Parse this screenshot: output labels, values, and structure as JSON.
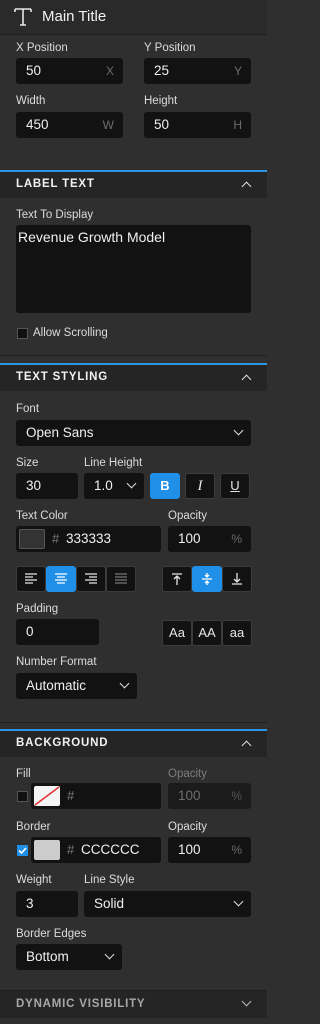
{
  "header": {
    "title": "Main Title",
    "icon": "text-tool-icon"
  },
  "position": {
    "x_label": "X Position",
    "x_value": "50",
    "x_unit": "X",
    "y_label": "Y Position",
    "y_value": "25",
    "y_unit": "Y",
    "w_label": "Width",
    "w_value": "450",
    "w_unit": "W",
    "h_label": "Height",
    "h_value": "50",
    "h_unit": "H"
  },
  "label_text": {
    "section_title": "LABEL TEXT",
    "text_label": "Text To Display",
    "text_value": "Revenue Growth Model",
    "scroll_label": "Allow Scrolling",
    "scroll_checked": false
  },
  "text_styling": {
    "section_title": "TEXT STYLING",
    "font_label": "Font",
    "font_value": "Open Sans",
    "size_label": "Size",
    "size_value": "30",
    "line_height_label": "Line Height",
    "line_height_value": "1.0",
    "bold_label": "B",
    "italic_label": "I",
    "underline_label": "U",
    "text_color_label": "Text Color",
    "text_color_hash": "#",
    "text_color_value": "333333",
    "opacity_label": "Opacity",
    "opacity_value": "100",
    "opacity_unit": "%",
    "padding_label": "Padding",
    "padding_value": "0",
    "case_buttons": [
      "Aa",
      "AA",
      "aa"
    ],
    "number_format_label": "Number Format",
    "number_format_value": "Automatic",
    "align_active": "center",
    "valign_active": "middle",
    "bold_active": true
  },
  "background": {
    "section_title": "BACKGROUND",
    "fill_label": "Fill",
    "fill_hash": "#",
    "fill_value": "",
    "fill_opacity_label": "Opacity",
    "fill_opacity_value": "100",
    "fill_opacity_unit": "%",
    "border_label": "Border",
    "border_hash": "#",
    "border_value": "CCCCCC",
    "border_opacity_label": "Opacity",
    "border_opacity_value": "100",
    "border_opacity_unit": "%",
    "weight_label": "Weight",
    "weight_value": "3",
    "line_style_label": "Line Style",
    "line_style_value": "Solid",
    "edges_label": "Border Edges",
    "edges_value": "Bottom",
    "border_color": "#cccccc",
    "fill_checked": false,
    "border_checked": true
  },
  "dynamic_visibility": {
    "section_title": "DYNAMIC VISIBILITY"
  },
  "colors": {
    "accent": "#2d95e6",
    "text_color_swatch": "#333333"
  }
}
